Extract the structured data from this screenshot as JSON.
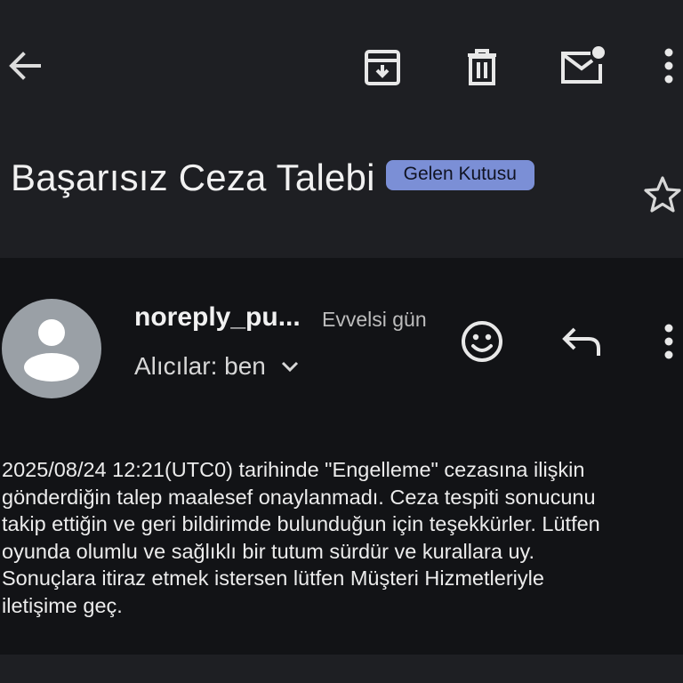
{
  "toolbar": {
    "back_icon": "arrow-left-icon",
    "archive_icon": "archive-icon",
    "delete_icon": "trash-icon",
    "unread_icon": "mark-unread-icon",
    "more_icon": "more-vertical-icon"
  },
  "email": {
    "subject": "Başarısız Ceza Talebi",
    "label": "Gelen Kutusu",
    "sender": "noreply_pu...",
    "date": "Evvelsi gün",
    "recipients": "Alıcılar: ben",
    "body_lines": [
      "2025/08/24 12:21(UTC0) tarihinde \"Engelleme\" cezasına ilişkin",
      "gönderdiğin talep maalesef onaylanmadı. Ceza tespiti sonucunu",
      "takip ettiğin ve geri bildirimde bulunduğun için teşekkürler. Lütfen",
      "oyunda olumlu ve sağlıklı bir tutum sürdür ve kurallara uy.",
      "Sonuçlara itiraz etmek istersen lütfen Müşteri Hizmetleriyle",
      "iletişime geç."
    ]
  },
  "colors": {
    "background": "#121316",
    "header": "#1e1f23",
    "label_chip": "#7b8fd6",
    "avatar": "#9aa0a6"
  }
}
